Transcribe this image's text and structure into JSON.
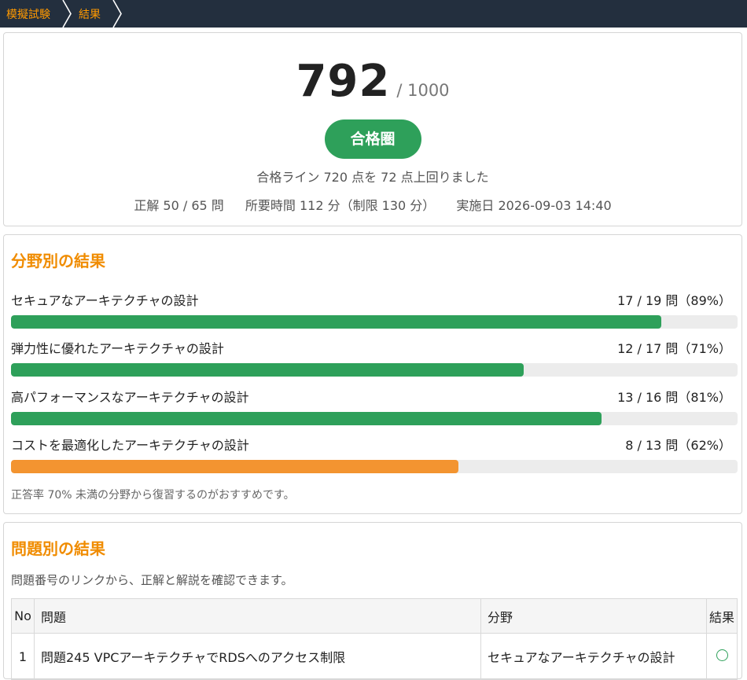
{
  "breadcrumb": {
    "items": [
      "模擬試験",
      "結果"
    ]
  },
  "score": {
    "value": "792",
    "max_label": "/ 1000",
    "badge": "合格圏",
    "message": "合格ライン 720 点を 72 点上回りました",
    "meta": {
      "correct": "正解 50 / 65 問",
      "time": "所要時間 112 分（制限 130 分）",
      "date": "実施日 2026-09-03 14:40"
    }
  },
  "categories": {
    "title": "分野別の結果",
    "items": [
      {
        "name": "セキュアなアーキテクチャの設計",
        "summary": "17 / 19 問（89%）",
        "ratio": 0.8947,
        "color": "#2ea05a"
      },
      {
        "name": "弾力性に優れたアーキテクチャの設計",
        "summary": "12 / 17 問（71%）",
        "ratio": 0.7059,
        "color": "#2ea05a"
      },
      {
        "name": "高パフォーマンスなアーキテクチャの設計",
        "summary": "13 / 16 問（81%）",
        "ratio": 0.8125,
        "color": "#2ea05a"
      },
      {
        "name": "コストを最適化したアーキテクチャの設計",
        "summary": "8 / 13 問（62%）",
        "ratio": 0.6154,
        "color": "#f39430"
      }
    ],
    "note": "正答率 70% 未満の分野から復習するのがおすすめです。"
  },
  "questions": {
    "title": "問題別の結果",
    "description": "問題番号のリンクから、正解と解説を確認できます。",
    "headers": {
      "no": "No",
      "question": "問題",
      "field": "分野",
      "result": "結果"
    },
    "rows": [
      {
        "no": "1",
        "question": "問題245 VPCアーキテクチャでRDSへのアクセス制限",
        "field": "セキュアなアーキテクチャの設計",
        "result": "○"
      }
    ]
  },
  "colors": {
    "accent": "#f08c00",
    "nav_bg": "#232f3e",
    "pass": "#2ea05a",
    "warn": "#f39430"
  }
}
